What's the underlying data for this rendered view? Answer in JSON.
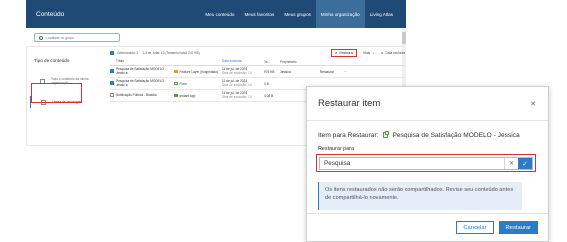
{
  "app": {
    "title": "Conteúdo",
    "nav": [
      "Meu conteúdo",
      "Meus favoritos",
      "Meus grupos",
      "Minha organização",
      "Living Atlas"
    ],
    "search_placeholder": "Localizar no grupo"
  },
  "sidebar": {
    "heading": "Tipo de conteúdo",
    "items": [
      {
        "label": "Todo o conteúdo da minha organização"
      },
      {
        "label": "Lixeira de reciclagem"
      }
    ]
  },
  "toolbar": {
    "selected": "Selecionado: 1",
    "range": "1-3 de, total: 13 (Tamanho total: 247 KB)",
    "restore": "Restaurar",
    "more": "Mais",
    "date_excluded": "Data excluída"
  },
  "table": {
    "columns": [
      "Título",
      "Data excluída",
      "Ta...",
      "Proprietário"
    ],
    "rows": [
      {
        "title": "Pesquisa de Satisfação MODELO - Jessic a",
        "type": "Feature Layer (hospedado)",
        "date": "11 de jul. de 2024",
        "ago": "Dias de exclusão: 14",
        "size": "976 KB",
        "owner": "Jessica",
        "status": "Restaurar"
      },
      {
        "title": "Pesquisa de Satisfação MODELO - Jessic a",
        "type": "Form",
        "date": "11 de jul. de 2024",
        "ago": "Dias de exclusão: 14",
        "size": "0 B",
        "owner": "",
        "status": ""
      },
      {
        "title": "Notificação Pública - Brasília",
        "type": "Instant App",
        "date": "11 de jul. de 2024",
        "ago": "Dias de exclusão: 14",
        "size": "4,08 B",
        "owner": "",
        "status": ""
      }
    ]
  },
  "dialog": {
    "title": "Restaurar item",
    "item_label": "Item para Restaurar:",
    "item_name": "Pesquisa de Satisfação MODELO - Jessica",
    "restore_to_label": "Restaurar para",
    "folder_value": "Pesquisa",
    "notice": "Os itens restaurados não serão compartilhados. Revise seu conteúdo antes de compartilhá-lo novamente.",
    "cancel": "Cancelar",
    "restore": "Restaurar"
  },
  "colors": {
    "header": "#1f4a75",
    "accent": "#2b7bc6",
    "highlight": "#d83033",
    "notice_bg": "#e5eef8"
  }
}
